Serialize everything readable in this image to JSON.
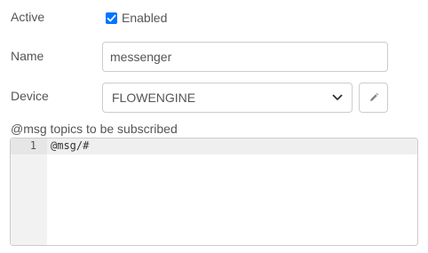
{
  "active": {
    "label": "Active",
    "checkbox_label": "Enabled",
    "checked": true
  },
  "name": {
    "label": "Name",
    "value": "messenger"
  },
  "device": {
    "label": "Device",
    "selected": "FLOWENGINE",
    "edit_icon": "pencil-icon"
  },
  "topics": {
    "label": "@msg topics to be subscribed",
    "lines": [
      {
        "number": "1",
        "text": "@msg/#"
      }
    ]
  },
  "colors": {
    "accent": "#0075ff",
    "border": "#cccccc",
    "text": "#555555",
    "gutter": "#f2f2f2"
  }
}
